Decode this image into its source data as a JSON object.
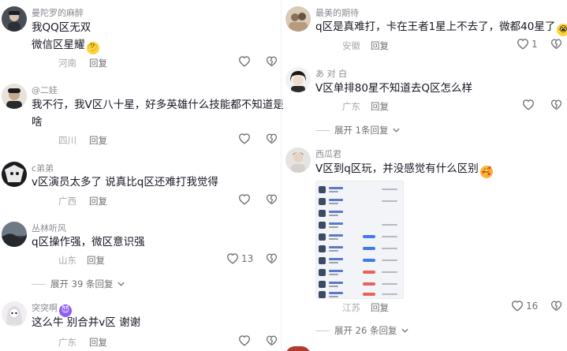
{
  "left_comments": [
    {
      "user": "曼陀罗的麻醉",
      "text": "我QQ区无双",
      "text2": "微信区星耀",
      "emoji": "thinking-emoji",
      "location": "河南",
      "reply": "回复",
      "likes": ""
    },
    {
      "user": "@二娃",
      "text": "我不行，我V区八十星，好多英雄什么技能都不知道是",
      "text2": "啥",
      "location": "四川",
      "reply": "回复",
      "likes": ""
    },
    {
      "user": "c弟弟",
      "text": "v区演员太多了 说真比q区还难打我觉得",
      "location": "广西",
      "reply": "回复",
      "likes": ""
    },
    {
      "user": "丛林听风",
      "text": "q区操作强，微区意识强",
      "location": "山东",
      "reply": "回复",
      "likes": "13",
      "expand": "展开 39 条回复"
    },
    {
      "user": "突突啊",
      "user_emoji": "devil-emoji",
      "text": "这么牛 别合并v区 谢谢",
      "location": "广东",
      "reply": "回复",
      "likes": ""
    }
  ],
  "right_comments": [
    {
      "user": "最美的期待",
      "text": "q区是真难打，卡在王者1星上不去了，微都40星了",
      "emoji": "crying-emoji",
      "location": "安徽",
      "reply": "回复",
      "likes": "1"
    },
    {
      "user": "あ 对 白",
      "text": "V区单排80星不知道去Q区怎么样",
      "location": "广东",
      "reply": "回复",
      "likes": "",
      "expand": "展开 1条回复"
    },
    {
      "user": "西瓜君",
      "text": "V区到q区玩，并没感觉有什么区别",
      "emoji": "blush-emoji",
      "location": "江苏",
      "reply": "回复",
      "likes": "16",
      "expand": "展开 26 条回复"
    }
  ],
  "colors": {
    "text": "#161823",
    "muted": "#a8a9ad",
    "action": "#6f7075"
  }
}
